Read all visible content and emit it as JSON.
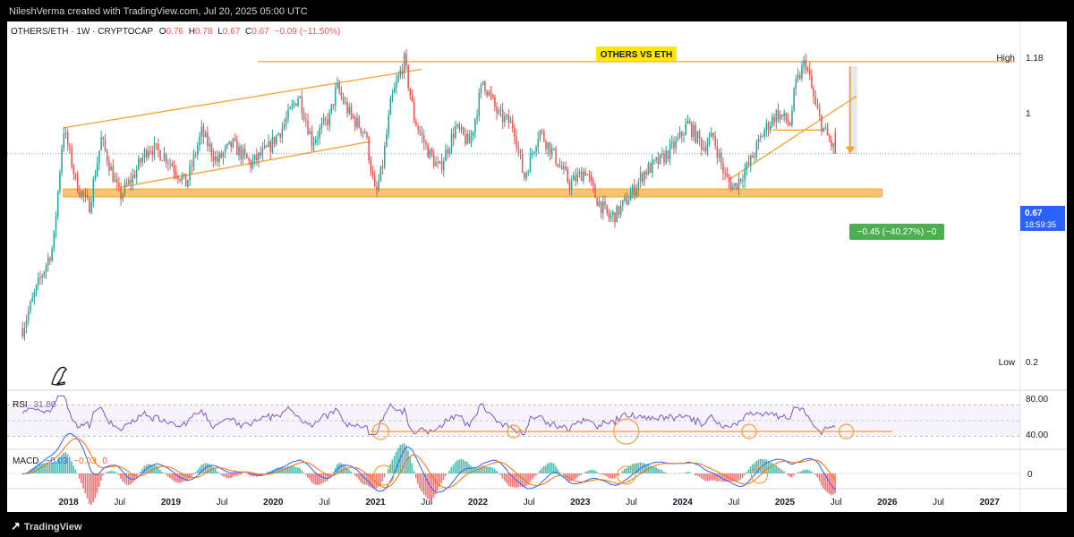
{
  "watermark": "NileshVerma created with TradingView.com, Jul 20, 2025 05:00 UTC",
  "footer_brand": "TradingView",
  "header": {
    "symbol": "OTHERS/ETH · 1W · CRYPTOCAP",
    "o_label": "O",
    "o": "0.76",
    "h_label": "H",
    "h": "0.78",
    "l_label": "L",
    "l": "0.67",
    "c_label": "C",
    "c": "0.67",
    "change": "−0.09 (−11.50%)"
  },
  "title_banner": "OTHERS VS ETH",
  "price_axis": {
    "high_label": "High",
    "high_value": "1.18",
    "tick_1": "1",
    "low_label": "Low",
    "low_value": "0.2",
    "last_price": "0.67",
    "countdown": "18:59:35"
  },
  "measure_label": "−0.45 (−40.27%) −0",
  "rsi": {
    "label": "RSI",
    "value": "31.80",
    "axis_top": "80.00",
    "axis_low": "40.00"
  },
  "macd": {
    "label": "MACD",
    "v1": "−0.03",
    "v2": "−0.03",
    "v3": "0",
    "axis_zero": "0"
  },
  "time_axis": [
    {
      "label": "2018",
      "bold": true,
      "x": 2018.0
    },
    {
      "label": "Jul",
      "bold": false,
      "x": 2018.5
    },
    {
      "label": "2019",
      "bold": true,
      "x": 2019.0
    },
    {
      "label": "Jul",
      "bold": false,
      "x": 2019.5
    },
    {
      "label": "2020",
      "bold": true,
      "x": 2020.0
    },
    {
      "label": "Jul",
      "bold": false,
      "x": 2020.5
    },
    {
      "label": "2021",
      "bold": true,
      "x": 2021.0
    },
    {
      "label": "Jul",
      "bold": false,
      "x": 2021.5
    },
    {
      "label": "2022",
      "bold": true,
      "x": 2022.0
    },
    {
      "label": "Jul",
      "bold": false,
      "x": 2022.5
    },
    {
      "label": "2023",
      "bold": true,
      "x": 2023.0
    },
    {
      "label": "Jul",
      "bold": false,
      "x": 2023.5
    },
    {
      "label": "2024",
      "bold": true,
      "x": 2024.0
    },
    {
      "label": "Jul",
      "bold": false,
      "x": 2024.5
    },
    {
      "label": "2025",
      "bold": true,
      "x": 2025.0
    },
    {
      "label": "Jul",
      "bold": false,
      "x": 2025.5
    },
    {
      "label": "2026",
      "bold": true,
      "x": 2026.0
    },
    {
      "label": "Jul",
      "bold": false,
      "x": 2026.5
    },
    {
      "label": "2027",
      "bold": true,
      "x": 2027.0
    }
  ],
  "colors": {
    "up": "#26a69a",
    "down": "#ef5350",
    "orange": "#f7a12d",
    "zone_fill": "#f8c471",
    "banner_bg": "#ffe600",
    "rsi_line": "#7e57c2",
    "macd_line": "#2962ff",
    "signal_line": "#ff6d00",
    "measure_bg": "#4caf50",
    "price_tag_bg": "#2962ff"
  },
  "chart_data": {
    "type": "candlestick",
    "title": "OTHERS VS ETH",
    "x_unit": "year",
    "xlim": [
      2017.4,
      2027.3
    ],
    "y_scale": "log",
    "ylim": [
      0.2,
      1.18
    ],
    "anchors": [
      [
        2017.55,
        0.24
      ],
      [
        2017.7,
        0.31
      ],
      [
        2017.85,
        0.39
      ],
      [
        2017.95,
        0.78
      ],
      [
        2018.08,
        0.56
      ],
      [
        2018.2,
        0.49
      ],
      [
        2018.32,
        0.73
      ],
      [
        2018.5,
        0.52
      ],
      [
        2018.62,
        0.58
      ],
      [
        2018.78,
        0.7
      ],
      [
        2018.95,
        0.66
      ],
      [
        2019.15,
        0.56
      ],
      [
        2019.3,
        0.76
      ],
      [
        2019.45,
        0.64
      ],
      [
        2019.6,
        0.71
      ],
      [
        2019.78,
        0.63
      ],
      [
        2019.95,
        0.69
      ],
      [
        2020.1,
        0.79
      ],
      [
        2020.25,
        0.95
      ],
      [
        2020.38,
        0.72
      ],
      [
        2020.55,
        0.83
      ],
      [
        2020.62,
        0.99
      ],
      [
        2020.75,
        0.84
      ],
      [
        2020.9,
        0.76
      ],
      [
        2021.0,
        0.52
      ],
      [
        2021.07,
        0.63
      ],
      [
        2021.15,
        0.91
      ],
      [
        2021.28,
        1.16
      ],
      [
        2021.38,
        0.82
      ],
      [
        2021.5,
        0.69
      ],
      [
        2021.62,
        0.61
      ],
      [
        2021.78,
        0.78
      ],
      [
        2021.92,
        0.71
      ],
      [
        2022.05,
        1.03
      ],
      [
        2022.2,
        0.84
      ],
      [
        2022.35,
        0.79
      ],
      [
        2022.45,
        0.58
      ],
      [
        2022.6,
        0.77
      ],
      [
        2022.75,
        0.66
      ],
      [
        2022.9,
        0.56
      ],
      [
        2023.05,
        0.61
      ],
      [
        2023.15,
        0.52
      ],
      [
        2023.28,
        0.46
      ],
      [
        2023.35,
        0.47
      ],
      [
        2023.5,
        0.53
      ],
      [
        2023.62,
        0.6
      ],
      [
        2023.8,
        0.65
      ],
      [
        2023.95,
        0.72
      ],
      [
        2024.05,
        0.8
      ],
      [
        2024.2,
        0.7
      ],
      [
        2024.3,
        0.74
      ],
      [
        2024.42,
        0.58
      ],
      [
        2024.5,
        0.55
      ],
      [
        2024.65,
        0.63
      ],
      [
        2024.8,
        0.77
      ],
      [
        2024.92,
        0.85
      ],
      [
        2025.05,
        0.8
      ],
      [
        2025.1,
        0.99
      ],
      [
        2025.2,
        1.16
      ],
      [
        2025.3,
        0.88
      ],
      [
        2025.38,
        0.77
      ],
      [
        2025.5,
        0.67
      ]
    ],
    "annotations": {
      "resistance_level": 1.15,
      "support_zone": [
        0.52,
        0.545
      ],
      "current_price": 0.67,
      "measure_from": 1.12,
      "measure_to": 0.67
    }
  }
}
